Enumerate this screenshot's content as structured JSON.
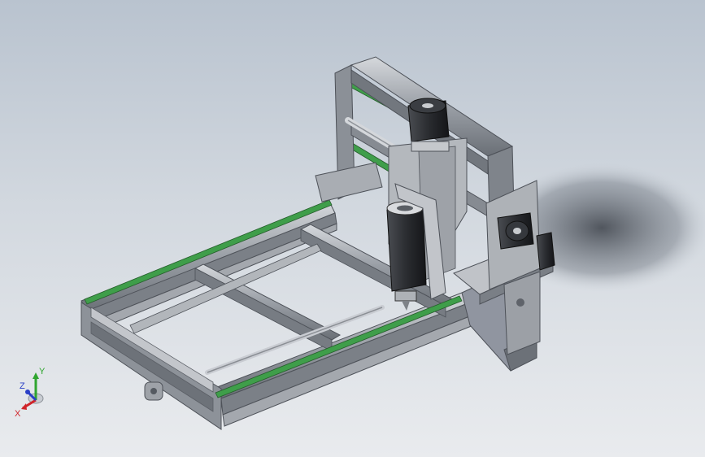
{
  "viewport": {
    "background_top": "#b9c3cf",
    "background_bottom": "#e9ebee"
  },
  "model": {
    "frame_color": "#8e939a",
    "frame_highlight": "#c9ccd1",
    "frame_shadow": "#5d6168",
    "rail_color": "#3f9e4a",
    "motor_color": "#2b2d31",
    "plate_color": "#a9adb3"
  },
  "triad": {
    "x_label": "X",
    "y_label": "Y",
    "z_label": "Z",
    "x_color": "#d0242a",
    "y_color": "#2fa52f",
    "z_color": "#2a3fc6"
  }
}
